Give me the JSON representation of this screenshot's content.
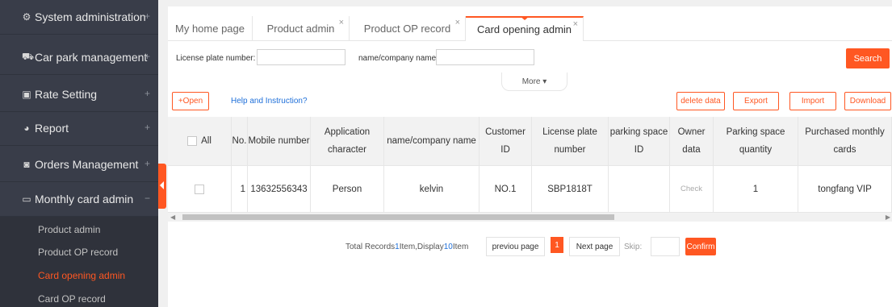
{
  "sidebar": {
    "items": [
      {
        "icon": "gear-icon",
        "glyph": "⚙",
        "label": "System administration",
        "toggle": "+"
      },
      {
        "icon": "car-icon",
        "glyph": "⛟",
        "label": "Car park management",
        "toggle": "+"
      },
      {
        "icon": "rate-icon",
        "glyph": "▣",
        "label": "Rate Setting",
        "toggle": "+"
      },
      {
        "icon": "report-icon",
        "glyph": "◕",
        "label": "Report",
        "toggle": "+"
      },
      {
        "icon": "orders-icon",
        "glyph": "◙",
        "label": "Orders Management",
        "toggle": "+"
      },
      {
        "icon": "card-icon",
        "glyph": "▭",
        "label": "Monthly card admin",
        "toggle": "−"
      }
    ],
    "sub_items": [
      "Product admin",
      "Product OP record",
      "Card opening admin",
      "Card OP record"
    ],
    "active_sub": "Card opening admin"
  },
  "tabs": [
    {
      "label": "My home page"
    },
    {
      "label": "Product admin",
      "close": "×"
    },
    {
      "label": "Product OP record",
      "close": "×"
    },
    {
      "label": "Card opening admin",
      "close": "×",
      "active": true
    }
  ],
  "search": {
    "license_label": "License plate number:",
    "license_value": "",
    "name_label": "name/company name:",
    "name_value": "",
    "search_button": "Search",
    "more_button": "More ▾"
  },
  "toolbar": {
    "open_button": "+Open",
    "help_link": "Help and Instruction?",
    "delete_button": "delete data",
    "export_button": "Export",
    "import_button": "Import",
    "download_button": "Download"
  },
  "table": {
    "headers": {
      "all": "All",
      "no": "No.",
      "mobile": "Mobile number",
      "app_char": "Application character",
      "name": "name/company name",
      "customer_id": "Customer ID",
      "plate": "License plate number",
      "space_id": "parking space ID",
      "owner": "Owner data",
      "space_qty": "Parking space quantity",
      "purchased": "Purchased monthly cards"
    },
    "rows": [
      {
        "no": "1",
        "mobile": "13632556343",
        "app_char": "Person",
        "name": "kelvin",
        "customer_id": "NO.1",
        "plate": "SBP1818T",
        "space_id": "",
        "owner": "Check",
        "space_qty": "1",
        "purchased": "tongfang VIP"
      }
    ]
  },
  "pager": {
    "total_prefix": "Total Records",
    "total_count": "1",
    "total_mid": "Item,Display",
    "display_count": "10",
    "total_suffix": "Item",
    "prev": "previou page",
    "current_page": "1",
    "next": "Next page",
    "skip_label": "Skip:",
    "skip_value": "",
    "confirm": "Confirm"
  },
  "colors": {
    "accent": "#ff5722",
    "sidebar_bg": "#393d49",
    "link": "#1e6fd9"
  }
}
